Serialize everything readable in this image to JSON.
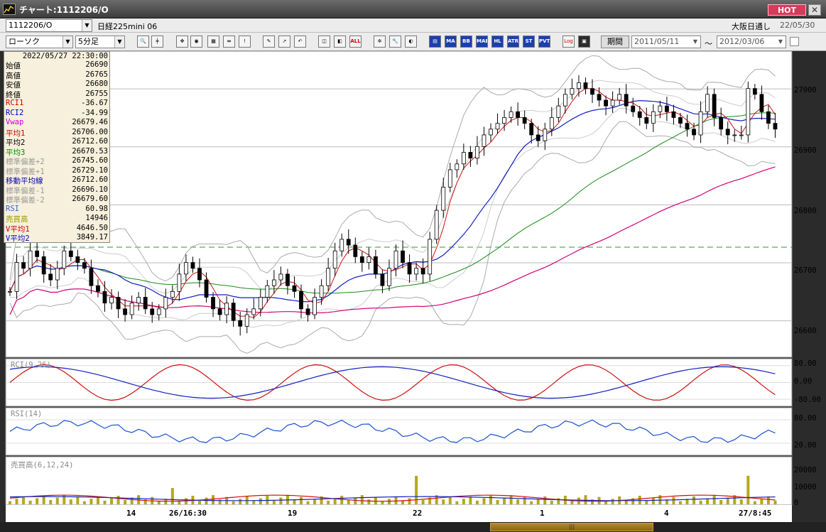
{
  "window": {
    "title": "チャート:1112206/O",
    "hot_label": "HOT",
    "close_label": "✕"
  },
  "row1": {
    "symbol_code": "1112206/O",
    "symbol_name": "日経225mini 06",
    "market": "大阪日通し",
    "date": "22/05/30"
  },
  "row2": {
    "chart_type": "ローソク",
    "timeframe": "5分足",
    "period_label": "期間",
    "date_from": "2011/05/11",
    "date_to": "2012/03/06",
    "range_sep": "〜",
    "buttons": [
      "MA",
      "BB",
      "MAE",
      "HL",
      "ATR",
      "ST",
      "PVT",
      "Log",
      "ALL"
    ]
  },
  "info_panel": {
    "datetime": "2022/05/27  22:30:00",
    "rows": [
      {
        "label": "始値",
        "value": "26690",
        "color": "#000000"
      },
      {
        "label": "高値",
        "value": "26765",
        "color": "#000000"
      },
      {
        "label": "安値",
        "value": "26680",
        "color": "#000000"
      },
      {
        "label": "終値",
        "value": "26755",
        "color": "#000000"
      },
      {
        "label": "RCI1",
        "value": "-36.67",
        "color": "#cc0000"
      },
      {
        "label": "RCI2",
        "value": "-34.99",
        "color": "#0000cc"
      },
      {
        "label": "Vwap",
        "value": "26679.46",
        "color": "#cc00cc"
      },
      {
        "label": "平均1",
        "value": "26706.00",
        "color": "#cc0000"
      },
      {
        "label": "平均2",
        "value": "26712.60",
        "color": "#000000"
      },
      {
        "label": "平均3",
        "value": "26670.53",
        "color": "#008800"
      },
      {
        "label": "標準偏差+2",
        "value": "26745.60",
        "color": "#999999"
      },
      {
        "label": "標準偏差+1",
        "value": "26729.10",
        "color": "#999999"
      },
      {
        "label": "移動平均線",
        "value": "26712.60",
        "color": "#0000aa"
      },
      {
        "label": "標準偏差-1",
        "value": "26696.10",
        "color": "#999999"
      },
      {
        "label": "標準偏差-2",
        "value": "26679.60",
        "color": "#999999"
      },
      {
        "label": "RSI",
        "value": "60.98",
        "color": "#3366cc"
      },
      {
        "label": "売買高",
        "value": "14946",
        "color": "#999900"
      },
      {
        "label": "V平均1",
        "value": "4646.50",
        "color": "#cc0000"
      },
      {
        "label": "V平均2",
        "value": "3849.17",
        "color": "#0000cc"
      }
    ]
  },
  "panels": {
    "rci_label": "RCI(9,26)",
    "rsi_label": "RSI(14)",
    "vol_label": "売買高(6,12,24)"
  },
  "axes": {
    "price_ticks": [
      "27000",
      "26900",
      "26800",
      "26700",
      "26600"
    ],
    "rci_ticks": [
      "80.00",
      "0.00",
      "-80.00"
    ],
    "rsi_ticks": [
      "80.00",
      "20.00"
    ],
    "vol_ticks": [
      "20000",
      "10000",
      "0"
    ],
    "x_ticks": [
      "14",
      "26/16:30",
      "19",
      "22",
      "1",
      "4",
      "27/8:45"
    ]
  },
  "chart_data": {
    "type": "candlestick",
    "ylim": [
      26550,
      27040
    ],
    "close": [
      26650,
      26700,
      26690,
      26720,
      26710,
      26680,
      26670,
      26690,
      26720,
      26710,
      26700,
      26690,
      26660,
      26650,
      26630,
      26640,
      26620,
      26610,
      26630,
      26640,
      26620,
      26610,
      26620,
      26640,
      26650,
      26680,
      26700,
      26690,
      26670,
      26640,
      26620,
      26610,
      26630,
      26600,
      26590,
      26610,
      26620,
      26640,
      26660,
      26670,
      26680,
      26660,
      26650,
      26620,
      26610,
      26640,
      26660,
      26690,
      26720,
      26740,
      26730,
      26710,
      26700,
      26710,
      26680,
      26660,
      26690,
      26720,
      26700,
      26680,
      26690,
      26680,
      26740,
      26790,
      26830,
      26860,
      26870,
      26890,
      26880,
      26900,
      26920,
      26930,
      26940,
      26950,
      26960,
      26950,
      26940,
      26920,
      26910,
      26930,
      26950,
      26970,
      26990,
      27000,
      27010,
      27000,
      26990,
      26980,
      26970,
      26980,
      26990,
      26970,
      26960,
      26950,
      26940,
      26960,
      26970,
      26960,
      26950,
      26940,
      26930,
      26920,
      26960,
      26990,
      26950,
      26930,
      26920,
      26920,
      26920,
      27000,
      26990,
      26960,
      26940,
      26930
    ]
  }
}
